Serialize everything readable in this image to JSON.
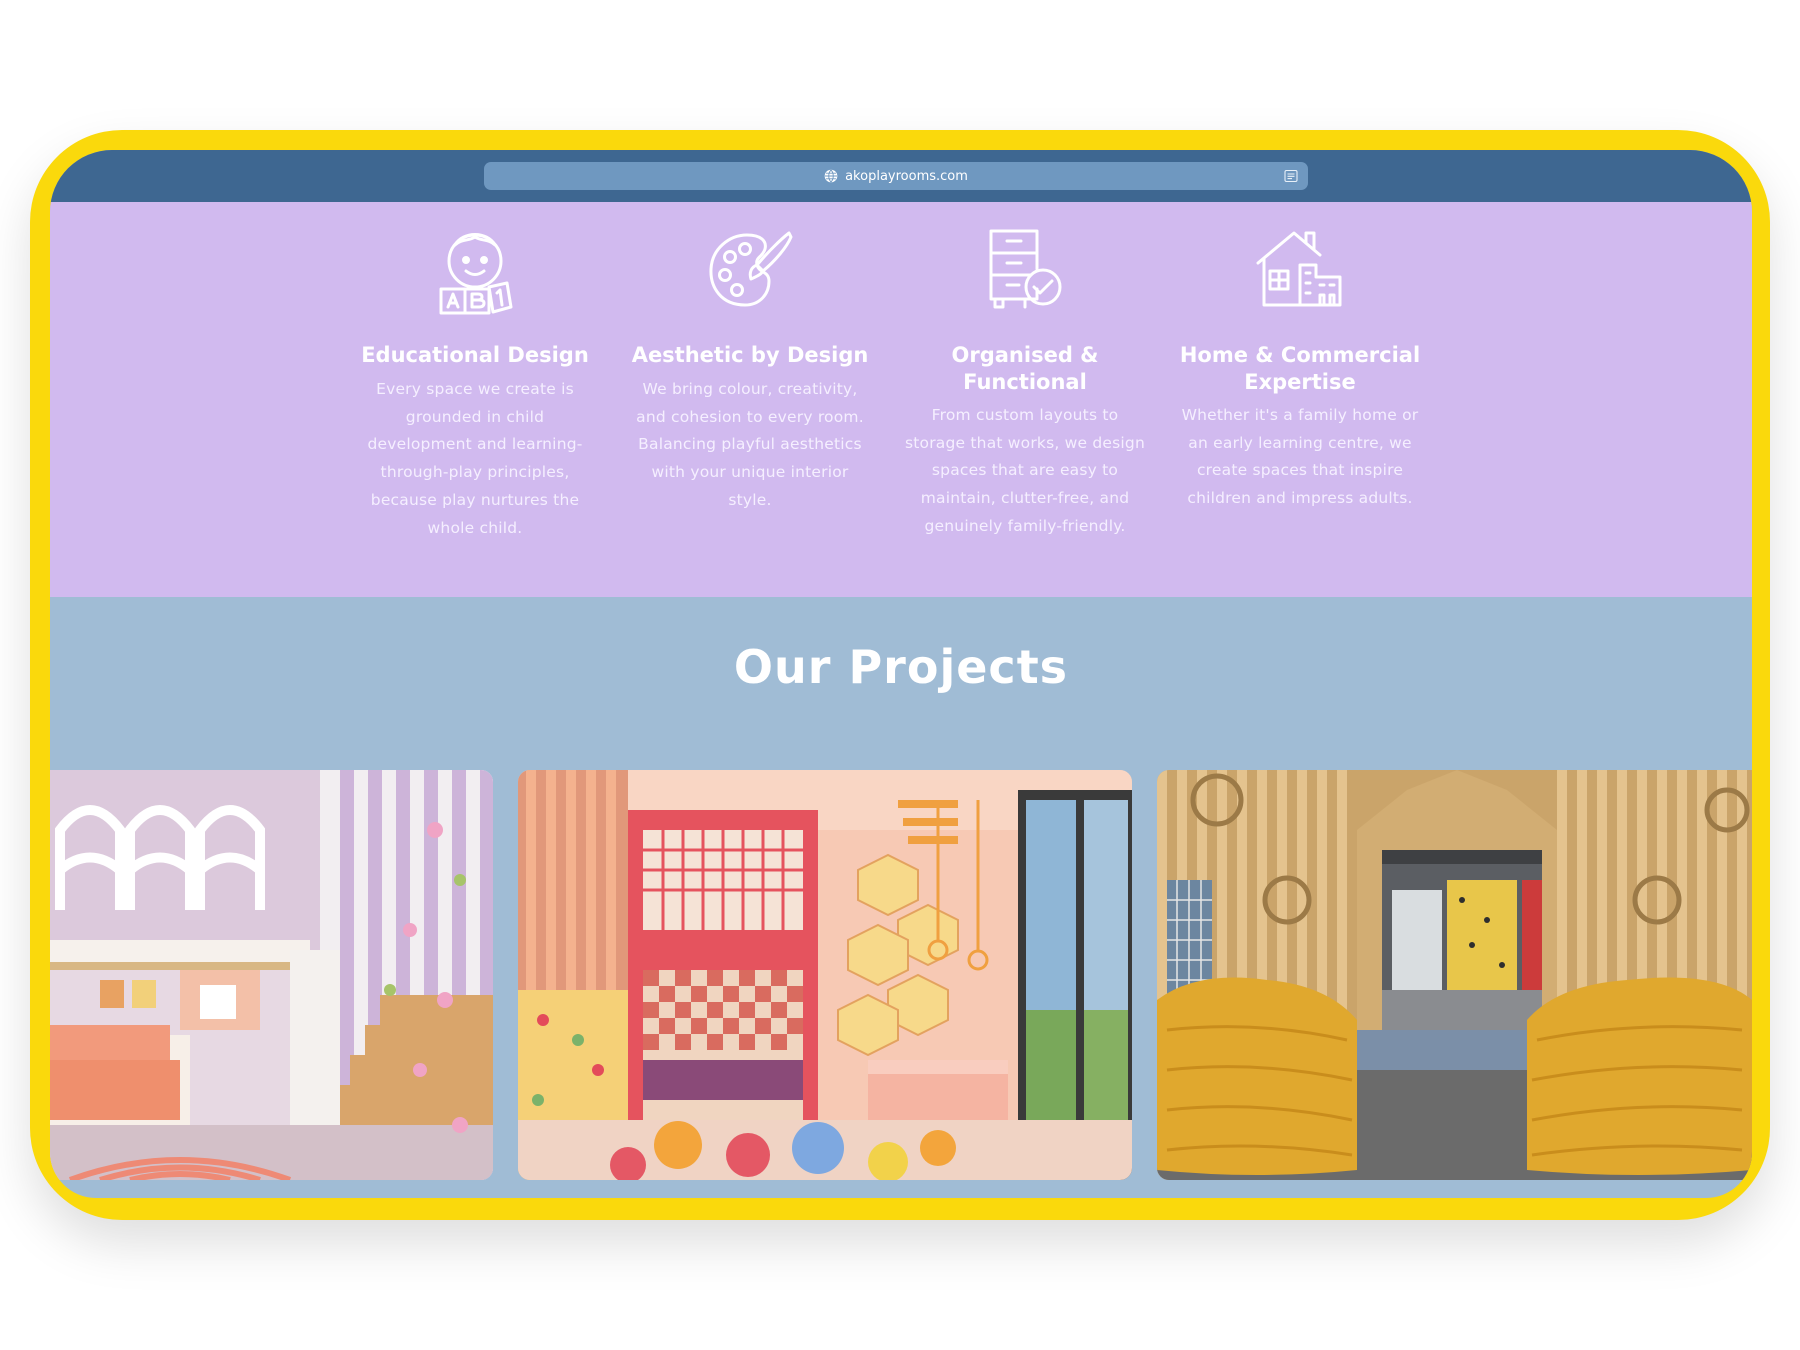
{
  "browser": {
    "url": "akoplayrooms.com",
    "icons": [
      "globe-icon",
      "reader-icon"
    ]
  },
  "features": [
    {
      "icon": "child-with-blocks-icon",
      "title": "Educational Design",
      "description": "Every space we create is grounded in child development and learning-through-play principles, because play nurtures the whole child."
    },
    {
      "icon": "paint-palette-icon",
      "title": "Aesthetic by Design",
      "description": "We bring colour, creativity, and cohesion to every room. Balancing playful aesthetics with your unique interior style."
    },
    {
      "icon": "organised-drawers-icon",
      "title": "Organised & Functional",
      "description": "From custom layouts to storage that works, we design spaces that are easy to maintain, clutter-free, and genuinely family-friendly."
    },
    {
      "icon": "home-and-building-icon",
      "title": "Home & Commercial Expertise",
      "description": "Whether it's a family home or an early learning centre, we create spaces that inspire children and impress adults."
    }
  ],
  "projects": {
    "title": "Our Projects"
  },
  "colors": {
    "frame": "#fad90c",
    "browser_bar": "#3e6791",
    "url_box": "#6f98c0",
    "features_bg": "#d1baef",
    "projects_bg": "#a0bcd5"
  }
}
